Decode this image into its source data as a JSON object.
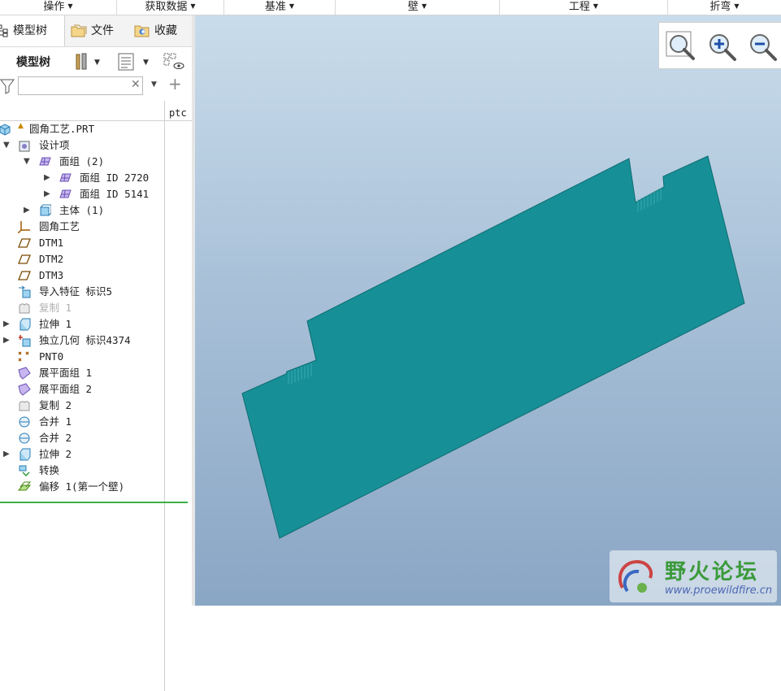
{
  "ribbon": {
    "groups": [
      {
        "label": "操作"
      },
      {
        "label": "获取数据"
      },
      {
        "label": "基准"
      },
      {
        "label": "壁"
      },
      {
        "label": "工程"
      },
      {
        "label": "折弯"
      }
    ]
  },
  "tabs": [
    {
      "label": "模型树",
      "icon": "model-tree-icon"
    },
    {
      "label": "文件",
      "icon": "folder-icon"
    },
    {
      "label": "收藏",
      "icon": "favorites-icon"
    }
  ],
  "toolbar": {
    "title": "模型树"
  },
  "filter": {
    "value": ""
  },
  "columns": {
    "ptc": "ptc"
  },
  "tree": [
    {
      "label": "圆角工艺.PRT",
      "icon": "part-icon",
      "expander": "none"
    },
    {
      "label": "设计项",
      "icon": "design-items-icon",
      "expander": "expanded"
    },
    {
      "label": "面组 (2)",
      "icon": "quilt-icon",
      "expander": "expanded"
    },
    {
      "label": "面组 ID 2720",
      "icon": "quilt-icon",
      "expander": "collapsed"
    },
    {
      "label": "面组 ID 5141",
      "icon": "quilt-icon",
      "expander": "collapsed"
    },
    {
      "label": "主体 (1)",
      "icon": "body-icon",
      "expander": "collapsed"
    },
    {
      "label": "圆角工艺",
      "icon": "csys-icon",
      "expander": "none"
    },
    {
      "label": "DTM1",
      "icon": "datum-plane-icon",
      "expander": "none"
    },
    {
      "label": "DTM2",
      "icon": "datum-plane-icon",
      "expander": "none"
    },
    {
      "label": "DTM3",
      "icon": "datum-plane-icon",
      "expander": "none"
    },
    {
      "label": "导入特征 标识5",
      "icon": "import-feature-icon",
      "expander": "none"
    },
    {
      "label": "复制 1",
      "icon": "copy-icon",
      "expander": "none",
      "dim": true
    },
    {
      "label": "拉伸 1",
      "icon": "extrude-icon",
      "expander": "collapsed"
    },
    {
      "label": "独立几何 标识4374",
      "icon": "independent-geometry-icon",
      "expander": "collapsed"
    },
    {
      "label": "PNT0",
      "icon": "datum-point-icon",
      "expander": "none"
    },
    {
      "label": "展平面组 1",
      "icon": "flatten-quilt-icon",
      "expander": "none"
    },
    {
      "label": "展平面组 2",
      "icon": "flatten-quilt-icon",
      "expander": "none"
    },
    {
      "label": "复制 2",
      "icon": "copy-icon",
      "expander": "none"
    },
    {
      "label": "合并 1",
      "icon": "merge-icon",
      "expander": "none"
    },
    {
      "label": "合并 2",
      "icon": "merge-icon",
      "expander": "none"
    },
    {
      "label": "拉伸 2",
      "icon": "extrude-icon",
      "expander": "collapsed"
    },
    {
      "label": "转换",
      "icon": "convert-icon",
      "expander": "none"
    },
    {
      "label": "偏移 1(第一个壁)",
      "icon": "offset-wall-icon",
      "expander": "none"
    }
  ],
  "viewport": {
    "model_color": "#178f96",
    "zoom_buttons": [
      {
        "icon": "zoom-fit-icon"
      },
      {
        "icon": "zoom-in-icon"
      },
      {
        "icon": "zoom-out-icon"
      }
    ],
    "watermark": {
      "title": "野火论坛",
      "url": "www.proewildfire.cn"
    }
  }
}
